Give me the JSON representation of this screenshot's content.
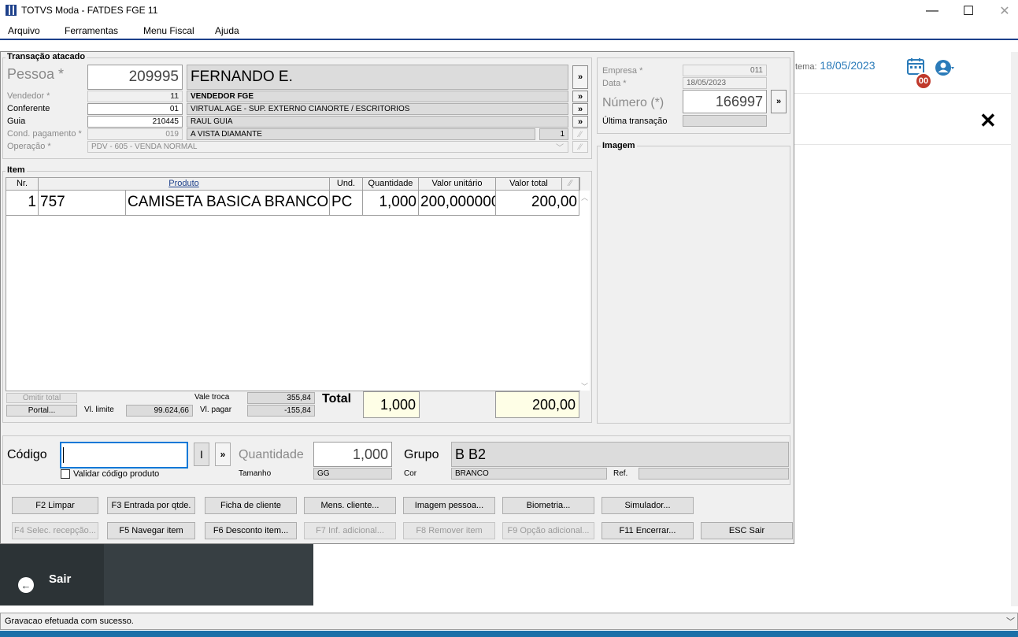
{
  "window": {
    "title": "TOTVS Moda - FATDES FGE 11",
    "min": "—",
    "max": "☐",
    "close": "✕"
  },
  "menu": [
    "Arquivo",
    "Ferramentas",
    "Menu Fiscal",
    "Ajuda"
  ],
  "background": {
    "sistema_label": "tema:",
    "sistema_date": "18/05/2023",
    "badge": "00",
    "close_x": "✕",
    "sair": "Sair"
  },
  "transacao": {
    "group_title": "Transação atacado",
    "pessoa_label": "Pessoa *",
    "pessoa_code": "209995",
    "pessoa_name": "FERNANDO E.",
    "vendedor_label": "Vendedor *",
    "vendedor_code": "11",
    "vendedor_name": "VENDEDOR FGE",
    "conferente_label": "Conferente",
    "conferente_code": "01",
    "conferente_name": "VIRTUAL AGE - SUP. EXTERNO CIANORTE / ESCRITORIOS",
    "guia_label": "Guia",
    "guia_code": "210445",
    "guia_name": "RAUL GUIA",
    "cond_label": "Cond. pagamento *",
    "cond_code": "019",
    "cond_name": "A VISTA DIAMANTE",
    "cond_parcelas": "1",
    "operacao_label": "Operação *",
    "operacao_value": "PDV - 605 - VENDA NORMAL"
  },
  "empresa": {
    "empresa_label": "Empresa *",
    "empresa_value": "011",
    "data_label": "Data *",
    "data_value": "18/05/2023",
    "numero_label": "Número (*)",
    "numero_value": "166997",
    "ultima_label": "Última transação",
    "imagem_label": "Imagem"
  },
  "item": {
    "group_title": "Item",
    "columns": [
      "Nr.",
      "Produto",
      "Und.",
      "Quantidade",
      "Valor unitário",
      "Valor total"
    ],
    "rows": [
      {
        "nr": "1",
        "codigo": "757",
        "produto": "CAMISETA BASICA BRANCO",
        "und": "PC",
        "quantidade": "1,000",
        "valor_unitario": "200,000000",
        "valor_total": "200,00"
      }
    ]
  },
  "totais": {
    "omitir": "Omitir total",
    "portal": "Portal...",
    "vl_limite_label": "Vl. limite",
    "vl_limite": "99.624,66",
    "vale_troca_label": "Vale troca",
    "vale_troca": "355,84",
    "vl_pagar_label": "Vl. pagar",
    "vl_pagar": "-155,84",
    "total_label": "Total",
    "total_qtd": "1,000",
    "total_valor": "200,00"
  },
  "entrada": {
    "codigo_label": "Código",
    "codigo_value": "",
    "i_button": "I",
    "more_button": "»",
    "validar_label": "Validar código produto",
    "quantidade_label": "Quantidade",
    "quantidade_value": "1,000",
    "tamanho_label": "Tamanho",
    "tamanho_value": "GG",
    "grupo_label": "Grupo",
    "grupo_value": "B B2",
    "cor_label": "Cor",
    "cor_value": "BRANCO",
    "ref_label": "Ref."
  },
  "buttons_row1": [
    "F2 Limpar",
    "F3 Entrada por qtde.",
    "Ficha de cliente",
    "Mens. cliente...",
    "Imagem pessoa...",
    "Biometria...",
    "Simulador..."
  ],
  "buttons_row2": [
    "F4 Selec. recepção...",
    "F5 Navegar item",
    "F6 Desconto item...",
    "F7 Inf. adicional...",
    "F8 Remover item",
    "F9 Opção adicional...",
    "F11 Encerrar...",
    "ESC Sair"
  ],
  "status": {
    "text": "Gravacao efetuada com sucesso."
  }
}
